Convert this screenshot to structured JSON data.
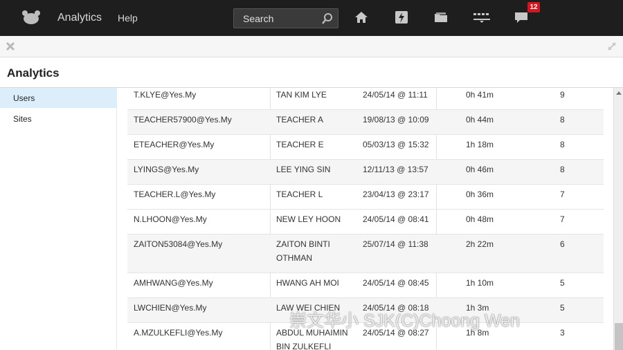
{
  "nav": {
    "app_label": "Analytics",
    "help_label": "Help",
    "search_label": "Search",
    "notification_count": "12"
  },
  "page": {
    "title": "Analytics"
  },
  "sidebar": {
    "items": [
      {
        "label": "Users"
      },
      {
        "label": "Sites"
      }
    ]
  },
  "table": {
    "rows": [
      {
        "user": "T.KLYE@Yes.My",
        "name": "TAN KIM LYE",
        "date": "24/05/14 @ 11:11",
        "duration": "0h 41m",
        "count": "9"
      },
      {
        "user": "TEACHER57900@Yes.My",
        "name": "TEACHER A",
        "date": "19/08/13 @ 10:09",
        "duration": "0h 44m",
        "count": "8"
      },
      {
        "user": "ETEACHER@Yes.My",
        "name": "TEACHER E",
        "date": "05/03/13 @ 15:32",
        "duration": "1h 18m",
        "count": "8"
      },
      {
        "user": "LYINGS@Yes.My",
        "name": "LEE YING SIN",
        "date": "12/11/13 @ 13:57",
        "duration": "0h 46m",
        "count": "8"
      },
      {
        "user": "TEACHER.L@Yes.My",
        "name": "TEACHER L",
        "date": "23/04/13 @ 23:17",
        "duration": "0h 36m",
        "count": "7"
      },
      {
        "user": "N.LHOON@Yes.My",
        "name": "NEW LEY HOON",
        "date": "24/05/14 @ 08:41",
        "duration": "0h 48m",
        "count": "7"
      },
      {
        "user": "ZAITON53084@Yes.My",
        "name": "ZAITON BINTI OTHMAN",
        "date": "25/07/14 @ 11:38",
        "duration": "2h 22m",
        "count": "6"
      },
      {
        "user": "AMHWANG@Yes.My",
        "name": "HWANG AH MOI",
        "date": "24/05/14 @ 08:45",
        "duration": "1h 10m",
        "count": "5"
      },
      {
        "user": "LWCHIEN@Yes.My",
        "name": "LAW WEI CHIEN",
        "date": "24/05/14 @ 08:18",
        "duration": "1h 3m",
        "count": "5"
      },
      {
        "user": "A.MZULKEFLI@Yes.My",
        "name": "ABDUL MUHAIMIN BIN ZULKEFLI",
        "date": "24/05/14 @ 08:27",
        "duration": "1h 8m",
        "count": "3"
      }
    ]
  },
  "watermark": "崇文华小 SJK(C)Choong Wen"
}
